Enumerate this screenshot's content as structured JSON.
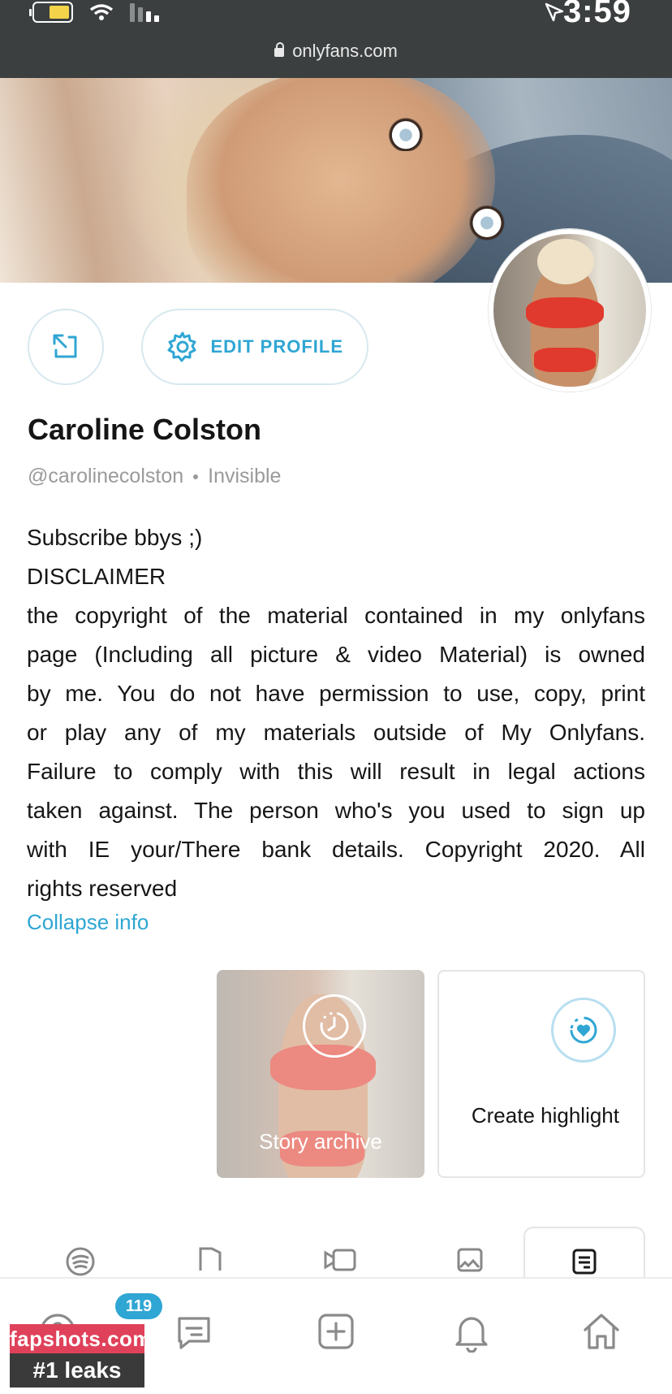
{
  "status_bar": {
    "time": "3:59",
    "url": "onlyfans.com"
  },
  "profile": {
    "name": "Caroline Colston",
    "handle": "@carolinecolston",
    "status": "Invisible",
    "edit_label": "EDIT PROFILE",
    "bio_lines": [
      "Subscribe bbys ;)",
      "DISCLAIMER",
      "the copyright of the material contained in my onlyfans",
      "page (Including all picture & video Material) is owned",
      "by me. You do not have permission to use, copy, print",
      "or play any of my materials outside of My Onlyfans.",
      "Failure to comply with this will result in legal actions",
      "taken against. The person who's you used to sign up",
      "with IE your/There bank details. Copyright 2020. All",
      "rights reserved"
    ],
    "collapse_label": "Collapse info"
  },
  "highlights": [
    {
      "label": "Create highlight",
      "icon": "heart-plus-icon"
    },
    {
      "label": "Story archive",
      "icon": "clock-icon"
    }
  ],
  "tabs": [
    {
      "icon": "posts-icon",
      "active": true
    },
    {
      "icon": "photos-icon"
    },
    {
      "icon": "videos-icon"
    },
    {
      "icon": "audio-icon"
    },
    {
      "icon": "spotify-icon"
    }
  ],
  "bottom_nav": {
    "badge_count": "119",
    "items": [
      "home-icon",
      "notifications-icon",
      "add-post-icon",
      "messages-icon",
      "profile-icon"
    ]
  },
  "watermark": {
    "top": "fapshots.com",
    "bottom": "#1 leaks"
  },
  "colors": {
    "accent": "#2fa6d3",
    "status_bar": "#3b3f3f"
  }
}
